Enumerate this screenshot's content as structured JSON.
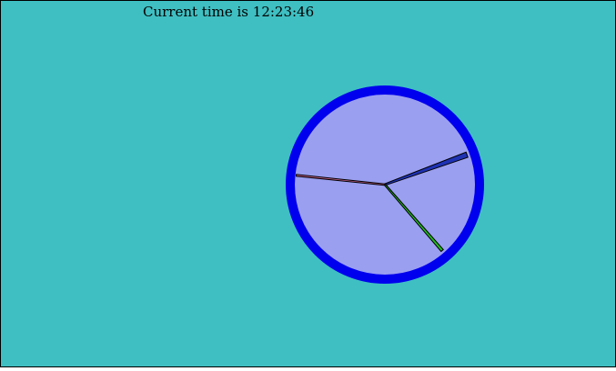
{
  "status": {
    "time_label": "Current time is 12:23:46"
  },
  "clock": {
    "time": {
      "hours": 12,
      "minutes": 23,
      "seconds": 46
    },
    "colors": {
      "background": "#3fbfc2",
      "rim": "#0000ee",
      "face": "#9b9ff0",
      "hour_hand": "#1e32b4",
      "minute_hand": "#22bb22",
      "second_hand": "#c0608a",
      "hand_outline": "#000000"
    }
  }
}
